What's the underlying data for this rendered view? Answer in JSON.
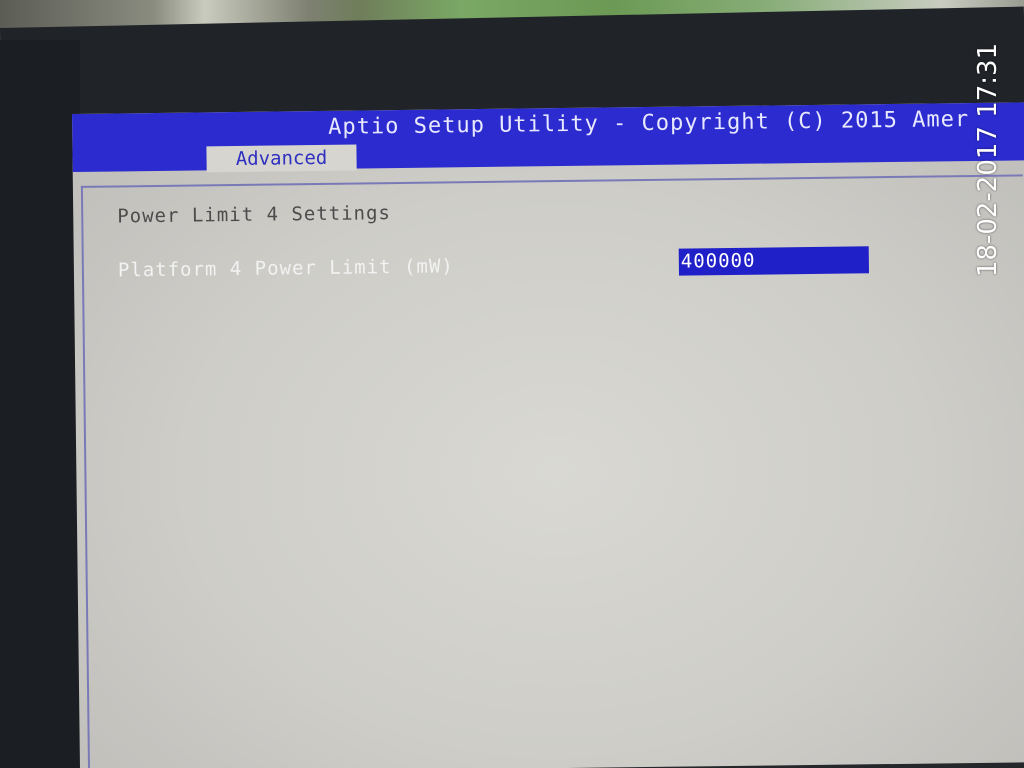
{
  "bios": {
    "title": "Aptio Setup Utility - Copyright (C) 2015 Amer",
    "active_tab": "Advanced",
    "section_title": "Power Limit 4 Settings",
    "settings": [
      {
        "label": "Platform 4 Power Limit (mW)",
        "value": "400000"
      }
    ]
  },
  "photo": {
    "timestamp": "18-02-2017 17:31"
  },
  "colors": {
    "title_bar": "#2b2bd0",
    "highlight": "#2020c8",
    "screen_bg": "#d0cfcb"
  }
}
